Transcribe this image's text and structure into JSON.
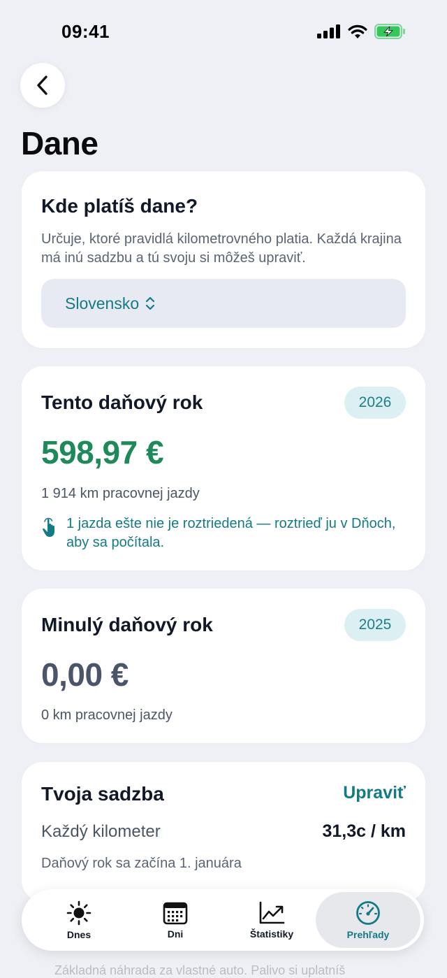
{
  "status": {
    "time": "09:41"
  },
  "page": {
    "title": "Dane"
  },
  "tax_country": {
    "title": "Kde platíš dane?",
    "description": "Určuje, ktoré pravidlá kilometrovného platia. Každá krajina má inú sadzbu a tú svoju si môžeš upraviť.",
    "selected": "Slovensko"
  },
  "current_year": {
    "title": "Tento daňový rok",
    "year": "2026",
    "amount": "598,97 €",
    "km": "1 914 km pracovnej jazdy",
    "notice": "1 jazda ešte nie je roztriedená — roztrieď ju v Dňoch, aby sa počítala."
  },
  "previous_year": {
    "title": "Minulý daňový rok",
    "year": "2025",
    "amount": "0,00 €",
    "km": "0 km pracovnej jazdy"
  },
  "rate": {
    "title": "Tvoja sadzba",
    "edit_label": "Upraviť",
    "label": "Každý kilometer",
    "value": "31,3c / km",
    "note": "Daňový rok sa začína 1. januára"
  },
  "tabs": [
    {
      "label": "Dnes",
      "icon": "sun-icon"
    },
    {
      "label": "Dni",
      "icon": "calendar-icon"
    },
    {
      "label": "Štatistiky",
      "icon": "chart-icon"
    },
    {
      "label": "Prehľady",
      "icon": "gauge-icon",
      "active": true
    }
  ],
  "bottom_text": "Základná náhrada za vlastné auto. Palivo si uplatníš",
  "colors": {
    "accent": "#137a86",
    "amount_positive": "#1e8a5a",
    "amount_zero": "#4b5569",
    "background": "#eef0f5"
  }
}
